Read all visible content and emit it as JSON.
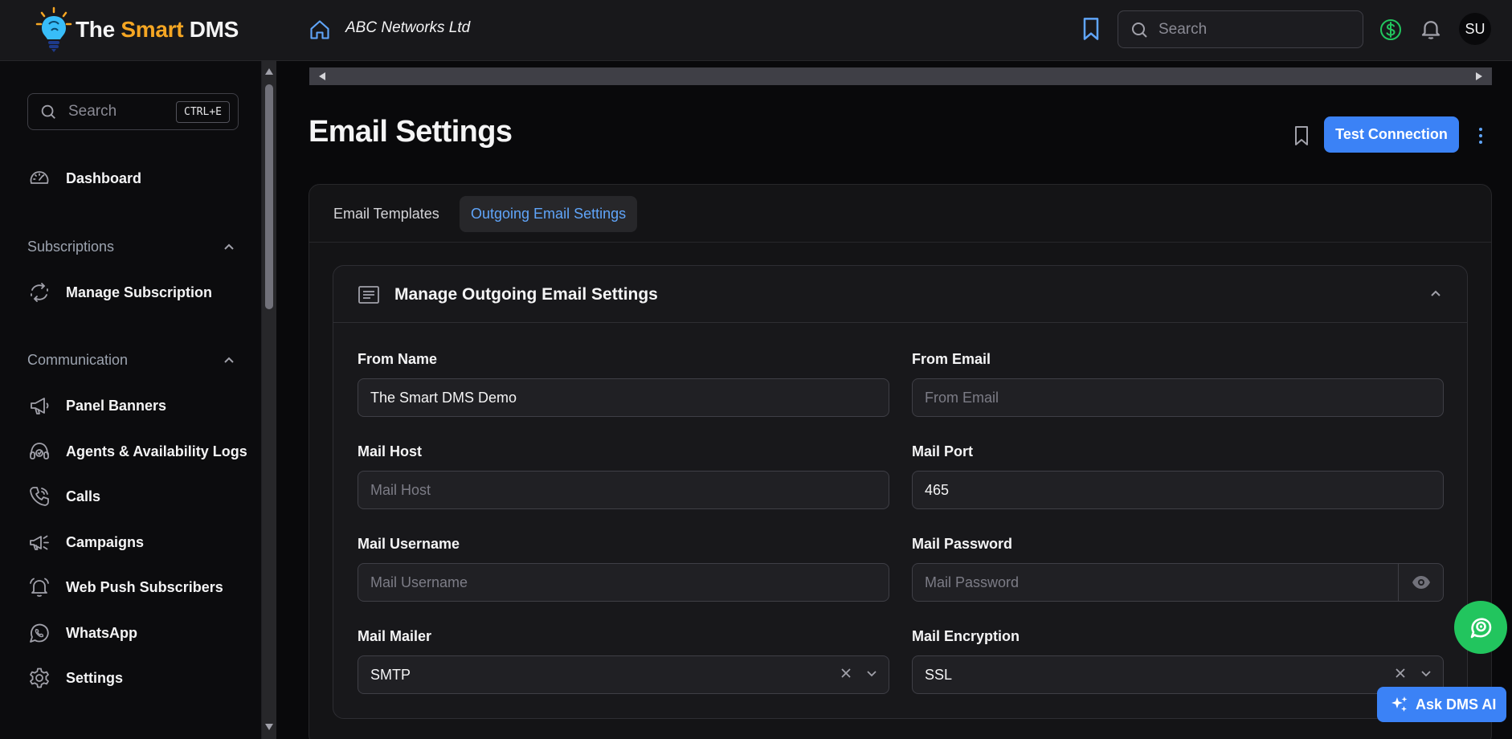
{
  "header": {
    "brand_prefix": "The ",
    "brand_accent": "Smart",
    "brand_suffix": " DMS",
    "org_name": "ABC Networks Ltd",
    "search_placeholder": "Search",
    "avatar_initials": "SU",
    "icons": [
      "logo-bulb-icon",
      "home-icon",
      "bookmark-icon",
      "search-icon",
      "dollar-icon",
      "bell-icon"
    ]
  },
  "sidebar": {
    "search_placeholder": "Search",
    "search_shortcut": "CTRL+E",
    "dashboard": "Dashboard",
    "sections": {
      "subscriptions": "Subscriptions",
      "communication": "Communication"
    },
    "items": {
      "manage_subscription": "Manage Subscription",
      "panel_banners": "Panel Banners",
      "agents": "Agents & Availability Logs",
      "calls": "Calls",
      "campaigns": "Campaigns",
      "web_push": "Web Push Subscribers",
      "whatsapp": "WhatsApp",
      "settings": "Settings"
    }
  },
  "main": {
    "title": "Email Settings",
    "test_connection": "Test Connection",
    "tabs": [
      "Email Templates",
      "Outgoing Email Settings"
    ],
    "active_tab": "Outgoing Email Settings",
    "panel_title": "Manage Outgoing Email Settings",
    "fields": {
      "from_name": {
        "label": "From Name",
        "value": "The Smart DMS Demo",
        "placeholder": ""
      },
      "from_email": {
        "label": "From Email",
        "value": "",
        "placeholder": "From Email"
      },
      "mail_host": {
        "label": "Mail Host",
        "value": "",
        "placeholder": "Mail Host"
      },
      "mail_port": {
        "label": "Mail Port",
        "value": "465",
        "placeholder": ""
      },
      "mail_username": {
        "label": "Mail Username",
        "value": "",
        "placeholder": "Mail Username"
      },
      "mail_password": {
        "label": "Mail Password",
        "value": "",
        "placeholder": "Mail Password"
      },
      "mail_mailer": {
        "label": "Mail Mailer",
        "value": "SMTP"
      },
      "mail_encryption": {
        "label": "Mail Encryption",
        "value": "SSL"
      }
    }
  },
  "floating": {
    "ask_label": "Ask DMS AI"
  },
  "colors": {
    "accent_blue": "#3b82f6",
    "brand_orange": "#f5a623",
    "whatsapp_green": "#22c55e",
    "active_tab_text": "#60a5fa"
  }
}
